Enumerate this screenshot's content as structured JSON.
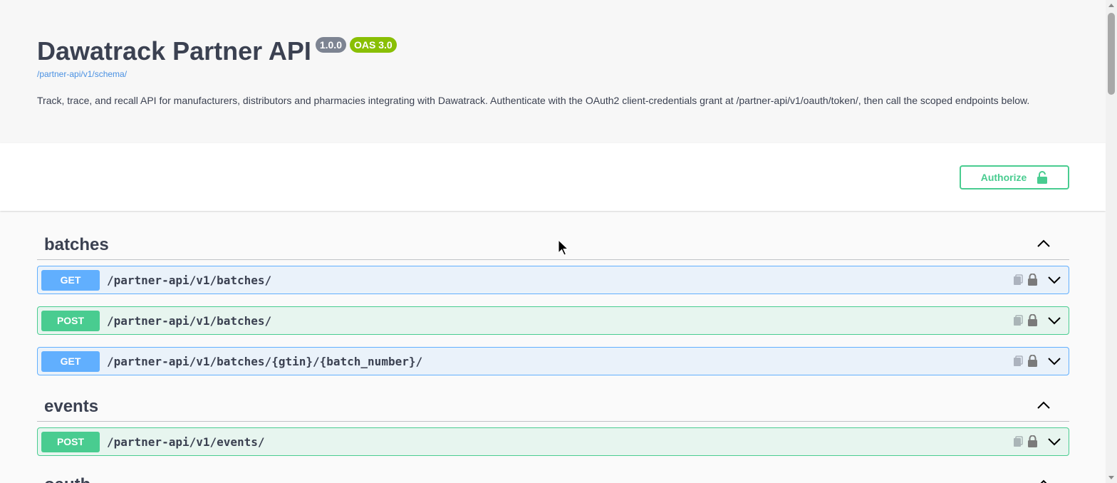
{
  "info": {
    "title": "Dawatrack Partner API",
    "version_badge": "1.0.0",
    "oas_badge": "OAS 3.0",
    "schema_link": "/partner-api/v1/schema/",
    "description": "Track, trace, and recall API for manufacturers, distributors and pharmacies integrating with Dawatrack. Authenticate with the OAuth2 client-credentials grant at /partner-api/v1/oauth/token/, then call the scoped endpoints below."
  },
  "authorize": {
    "label": "Authorize",
    "icon": "unlock-icon"
  },
  "tags": [
    {
      "name": "batches",
      "operations": [
        {
          "method": "GET",
          "path": "/partner-api/v1/batches/"
        },
        {
          "method": "POST",
          "path": "/partner-api/v1/batches/"
        },
        {
          "method": "GET",
          "path": "/partner-api/v1/batches/{gtin}/{batch_number}/"
        }
      ]
    },
    {
      "name": "events",
      "operations": [
        {
          "method": "POST",
          "path": "/partner-api/v1/events/"
        }
      ]
    },
    {
      "name": "oauth",
      "operations": []
    }
  ],
  "colors": {
    "get": "#61affe",
    "post": "#49cc90",
    "text": "#3b4151",
    "version_badge": "#7d8492",
    "oas_badge": "#89bf04",
    "link": "#4990e2"
  }
}
